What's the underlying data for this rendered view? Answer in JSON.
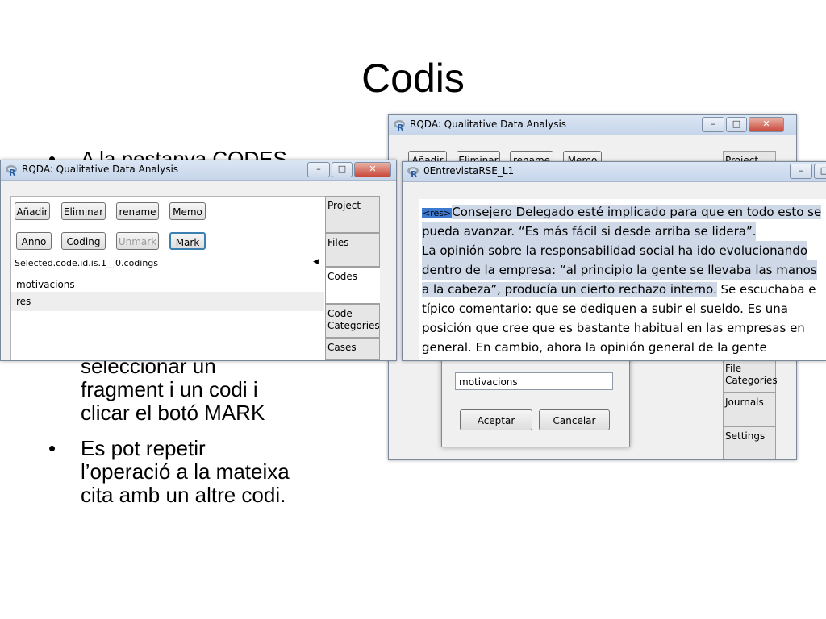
{
  "slide": {
    "title": "Codis",
    "bullets": [
      {
        "text": "A la pestanya CODES"
      },
      {
        "text": "seleccionar un\nfragment i un codi i\nclicar el botó MARK"
      },
      {
        "text": "Es pot repetir\nl’operació a la mateixa\ncita amb un altre codi."
      }
    ],
    "bullet_char": "•"
  },
  "back_window": {
    "title": "RQDA: Qualitative Data Analysis",
    "buttons": [
      "Añadir",
      "Eliminar",
      "rename",
      "Memo"
    ],
    "tabs": [
      "Project",
      "File\nCategories",
      "Journals",
      "Settings"
    ],
    "dialog": {
      "input_value": "motivacions",
      "ok": "Aceptar",
      "cancel": "Cancelar"
    }
  },
  "front_window": {
    "title": "RQDA: Qualitative Data Analysis",
    "buttons_row1": [
      "Añadir",
      "Eliminar",
      "rename",
      "Memo"
    ],
    "buttons_row2": [
      "Anno",
      "Coding",
      "Unmark",
      "Mark"
    ],
    "selected_label": "Selected.code.id.is.1__0.codings",
    "codes": [
      "motivacions",
      "res"
    ],
    "tabs": [
      "Project",
      "Files",
      "Codes",
      "Code\nCategories",
      "Cases"
    ]
  },
  "text_window": {
    "title": "0EntrevistaRSE_L1",
    "tag": "<res>",
    "lines": [
      "Consejero Delegado esté implicado para que en todo esto se",
      "pueda avanzar. “Es más fácil si desde arriba se lidera”.",
      "La opinión sobre la responsabilidad social ha ido evolucionando",
      "dentro de la empresa: “al principio la gente se llevaba las manos",
      "a la cabeza”, producía un cierto rechazo interno.",
      " Se escuchaba e",
      "típico comentario: que se dediquen a subir el sueldo. Es una",
      "posición que cree que es bastante habitual en las empresas en",
      "general. En cambio, ahora la opinión general de la gente"
    ]
  },
  "colors": {
    "accent": "#3c7fb1",
    "titlebar": "#c6d5ea",
    "close": "#c9473a",
    "highlight": "#cfd8e6"
  },
  "icons": [
    "r-logo-icon",
    "minimize-icon",
    "maximize-icon",
    "close-icon",
    "scroll-arrow-icon"
  ]
}
